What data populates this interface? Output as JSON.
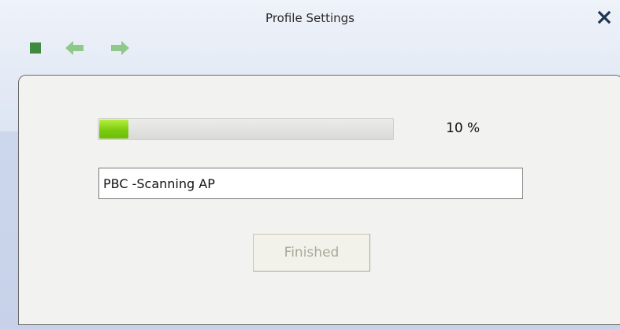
{
  "window": {
    "title": "Profile Settings"
  },
  "toolbar": {
    "icons": [
      "stop-icon",
      "back-arrow-icon",
      "forward-arrow-icon"
    ],
    "close_icon": "close-icon"
  },
  "progress": {
    "value_percent": 10,
    "label": "10 %",
    "fill_color": "#7ccc10"
  },
  "status": {
    "value": "PBC -Scanning AP"
  },
  "buttons": {
    "finished_label": "Finished",
    "finished_enabled": false
  },
  "colors": {
    "header_background": "#dde5f3",
    "panel_background": "#f2f2f0",
    "icon_green": "#3f8a3f",
    "arrow_green": "#8fc98a"
  }
}
